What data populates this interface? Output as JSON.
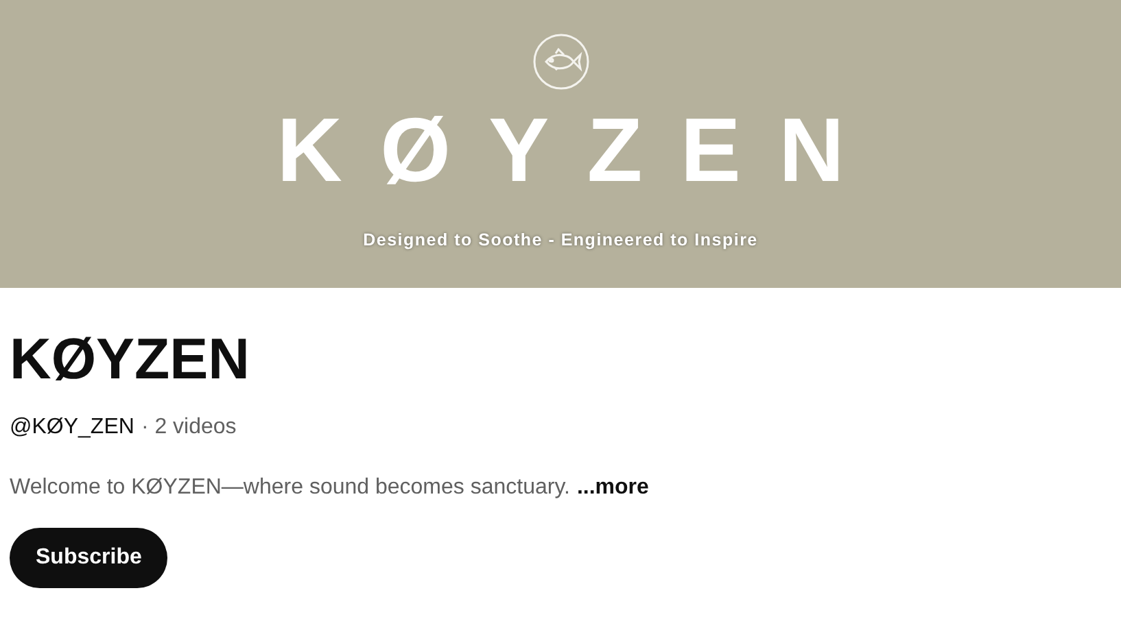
{
  "banner": {
    "wordmark": "KØYZEN",
    "tagline": "Designed to Soothe - Engineered to Inspire"
  },
  "channel": {
    "name": "KØYZEN",
    "handle": "@KØY_ZEN",
    "video_count": "· 2 videos",
    "description": "Welcome to KØYZEN—where sound becomes sanctuary.",
    "more_link": "...more"
  },
  "buttons": [
    {
      "label": "Subscribe",
      "kind": "primary"
    }
  ]
}
